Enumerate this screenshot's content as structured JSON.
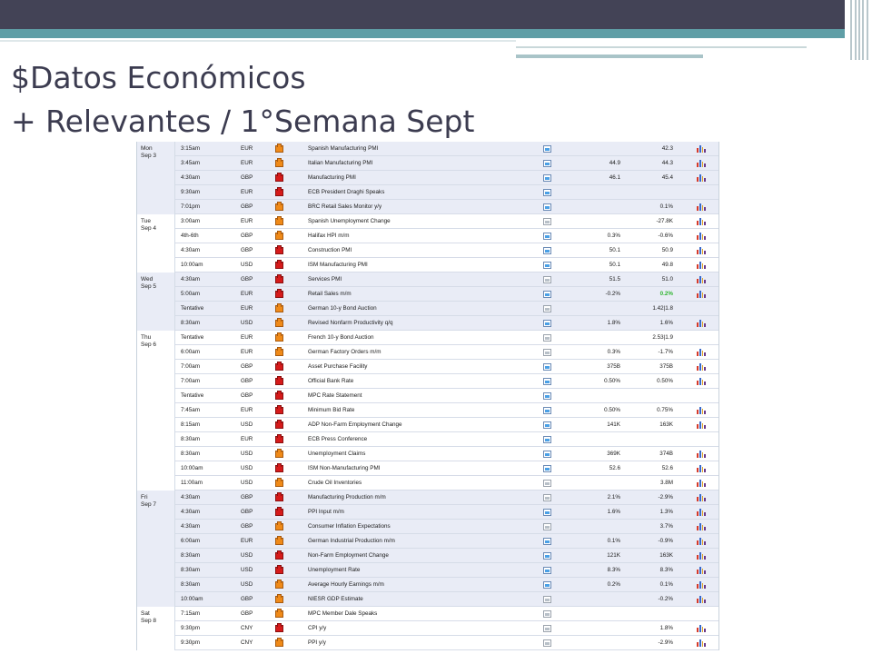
{
  "slide": {
    "title_line1": "$Datos Económicos",
    "title_line2": "+ Relevantes / 1°Semana Sept"
  },
  "colors": {
    "header_dark": "#434356",
    "header_teal": "#5f9ea6",
    "row_shade": "#e9ecf6",
    "positive": "#2fb52f"
  },
  "calendar": {
    "groups": [
      {
        "day": "Mon",
        "date": "Sep 3",
        "rows": [
          {
            "time": "3:15am",
            "currency": "EUR",
            "impact": "med",
            "event": "Spanish Manufacturing PMI",
            "detail": "active",
            "forecast": "",
            "previous": "42.3",
            "chart": true
          },
          {
            "time": "3:45am",
            "currency": "EUR",
            "impact": "med",
            "event": "Italian Manufacturing PMI",
            "detail": "active",
            "forecast": "44.9",
            "previous": "44.3",
            "chart": true
          },
          {
            "time": "4:30am",
            "currency": "GBP",
            "impact": "high",
            "event": "Manufacturing PMI",
            "detail": "active",
            "forecast": "46.1",
            "previous": "45.4",
            "chart": true
          },
          {
            "time": "9:30am",
            "currency": "EUR",
            "impact": "high",
            "event": "ECB President Draghi Speaks",
            "detail": "active",
            "forecast": "",
            "previous": "",
            "chart": false
          },
          {
            "time": "7:01pm",
            "currency": "GBP",
            "impact": "med",
            "event": "BRC Retail Sales Monitor y/y",
            "detail": "active",
            "forecast": "",
            "previous": "0.1%",
            "chart": true
          }
        ]
      },
      {
        "day": "Tue",
        "date": "Sep 4",
        "rows": [
          {
            "time": "3:00am",
            "currency": "EUR",
            "impact": "med",
            "event": "Spanish Unemployment Change",
            "detail": "muted",
            "forecast": "",
            "previous": "-27.8K",
            "chart": true
          },
          {
            "time": "4th-6th",
            "currency": "GBP",
            "impact": "med",
            "event": "Halifax HPI m/m",
            "detail": "active",
            "forecast": "0.3%",
            "previous": "-0.6%",
            "chart": true
          },
          {
            "time": "4:30am",
            "currency": "GBP",
            "impact": "high",
            "event": "Construction PMI",
            "detail": "active",
            "forecast": "50.1",
            "previous": "50.9",
            "chart": true
          },
          {
            "time": "10:00am",
            "currency": "USD",
            "impact": "high",
            "event": "ISM Manufacturing PMI",
            "detail": "active",
            "forecast": "50.1",
            "previous": "49.8",
            "chart": true
          }
        ]
      },
      {
        "day": "Wed",
        "date": "Sep 5",
        "rows": [
          {
            "time": "4:30am",
            "currency": "GBP",
            "impact": "high",
            "event": "Services PMI",
            "detail": "muted",
            "forecast": "51.5",
            "previous": "51.0",
            "chart": true
          },
          {
            "time": "5:00am",
            "currency": "EUR",
            "impact": "high",
            "event": "Retail Sales m/m",
            "detail": "active",
            "forecast": "-0.2%",
            "previous": "0.2%",
            "previous_up": true,
            "chart": true
          },
          {
            "time": "Tentative",
            "currency": "EUR",
            "impact": "med",
            "event": "German 10-y Bond Auction",
            "detail": "muted",
            "forecast": "",
            "previous": "1.42|1.8",
            "chart": false
          },
          {
            "time": "8:30am",
            "currency": "USD",
            "impact": "med",
            "event": "Revised Nonfarm Productivity q/q",
            "detail": "active",
            "forecast": "1.8%",
            "previous": "1.6%",
            "chart": true
          }
        ]
      },
      {
        "day": "Thu",
        "date": "Sep 6",
        "rows": [
          {
            "time": "Tentative",
            "currency": "EUR",
            "impact": "med",
            "event": "French 10-y Bond Auction",
            "detail": "muted",
            "forecast": "",
            "previous": "2.53|1.9",
            "chart": false
          },
          {
            "time": "6:00am",
            "currency": "EUR",
            "impact": "med",
            "event": "German Factory Orders m/m",
            "detail": "muted",
            "forecast": "0.3%",
            "previous": "-1.7%",
            "chart": true
          },
          {
            "time": "7:00am",
            "currency": "GBP",
            "impact": "high",
            "event": "Asset Purchase Facility",
            "detail": "active",
            "forecast": "375B",
            "previous": "375B",
            "chart": true
          },
          {
            "time": "7:00am",
            "currency": "GBP",
            "impact": "high",
            "event": "Official Bank Rate",
            "detail": "active",
            "forecast": "0.50%",
            "previous": "0.50%",
            "chart": true
          },
          {
            "time": "Tentative",
            "currency": "GBP",
            "impact": "high",
            "event": "MPC Rate Statement",
            "detail": "active",
            "forecast": "",
            "previous": "",
            "chart": false
          },
          {
            "time": "7:45am",
            "currency": "EUR",
            "impact": "high",
            "event": "Minimum Bid Rate",
            "detail": "active",
            "forecast": "0.50%",
            "previous": "0.75%",
            "chart": true
          },
          {
            "time": "8:15am",
            "currency": "USD",
            "impact": "high",
            "event": "ADP Non-Farm Employment Change",
            "detail": "active",
            "forecast": "141K",
            "previous": "163K",
            "chart": true
          },
          {
            "time": "8:30am",
            "currency": "EUR",
            "impact": "high",
            "event": "ECB Press Conference",
            "detail": "active",
            "forecast": "",
            "previous": "",
            "chart": false
          },
          {
            "time": "8:30am",
            "currency": "USD",
            "impact": "med",
            "event": "Unemployment Claims",
            "detail": "active",
            "forecast": "369K",
            "previous": "374B",
            "chart": true
          },
          {
            "time": "10:00am",
            "currency": "USD",
            "impact": "high",
            "event": "ISM Non-Manufacturing PMI",
            "detail": "active",
            "forecast": "52.6",
            "previous": "52.6",
            "chart": true
          },
          {
            "time": "11:00am",
            "currency": "USD",
            "impact": "med",
            "event": "Crude Oil Inventories",
            "detail": "muted",
            "forecast": "",
            "previous": "3.8M",
            "chart": true
          }
        ]
      },
      {
        "day": "Fri",
        "date": "Sep 7",
        "rows": [
          {
            "time": "4:30am",
            "currency": "GBP",
            "impact": "high",
            "event": "Manufacturing Production m/m",
            "detail": "muted",
            "forecast": "2.1%",
            "previous": "-2.9%",
            "chart": true
          },
          {
            "time": "4:30am",
            "currency": "GBP",
            "impact": "high",
            "event": "PPI Input m/m",
            "detail": "active",
            "forecast": "1.6%",
            "previous": "1.3%",
            "chart": true
          },
          {
            "time": "4:30am",
            "currency": "GBP",
            "impact": "med",
            "event": "Consumer Inflation Expectations",
            "detail": "muted",
            "forecast": "",
            "previous": "3.7%",
            "chart": true
          },
          {
            "time": "6:00am",
            "currency": "EUR",
            "impact": "med",
            "event": "German Industrial Production m/m",
            "detail": "active",
            "forecast": "0.1%",
            "previous": "-0.9%",
            "chart": true
          },
          {
            "time": "8:30am",
            "currency": "USD",
            "impact": "high",
            "event": "Non-Farm Employment Change",
            "detail": "active",
            "forecast": "121K",
            "previous": "163K",
            "chart": true
          },
          {
            "time": "8:30am",
            "currency": "USD",
            "impact": "high",
            "event": "Unemployment Rate",
            "detail": "active",
            "forecast": "8.3%",
            "previous": "8.3%",
            "chart": true
          },
          {
            "time": "8:30am",
            "currency": "USD",
            "impact": "med",
            "event": "Average Hourly Earnings m/m",
            "detail": "active",
            "forecast": "0.2%",
            "previous": "0.1%",
            "chart": true
          },
          {
            "time": "10:00am",
            "currency": "GBP",
            "impact": "med",
            "event": "NIESR GDP Estimate",
            "detail": "muted",
            "forecast": "",
            "previous": "-0.2%",
            "chart": true
          }
        ]
      },
      {
        "day": "Sat",
        "date": "Sep 8",
        "rows": [
          {
            "time": "7:15am",
            "currency": "GBP",
            "impact": "med",
            "event": "MPC Member Dale Speaks",
            "detail": "muted",
            "forecast": "",
            "previous": "",
            "chart": false
          },
          {
            "time": "9:30pm",
            "currency": "CNY",
            "impact": "high",
            "event": "CPI y/y",
            "detail": "muted",
            "forecast": "",
            "previous": "1.8%",
            "chart": true
          },
          {
            "time": "9:30pm",
            "currency": "CNY",
            "impact": "med",
            "event": "PPI y/y",
            "detail": "muted",
            "forecast": "",
            "previous": "-2.9%",
            "chart": true
          }
        ]
      }
    ]
  }
}
